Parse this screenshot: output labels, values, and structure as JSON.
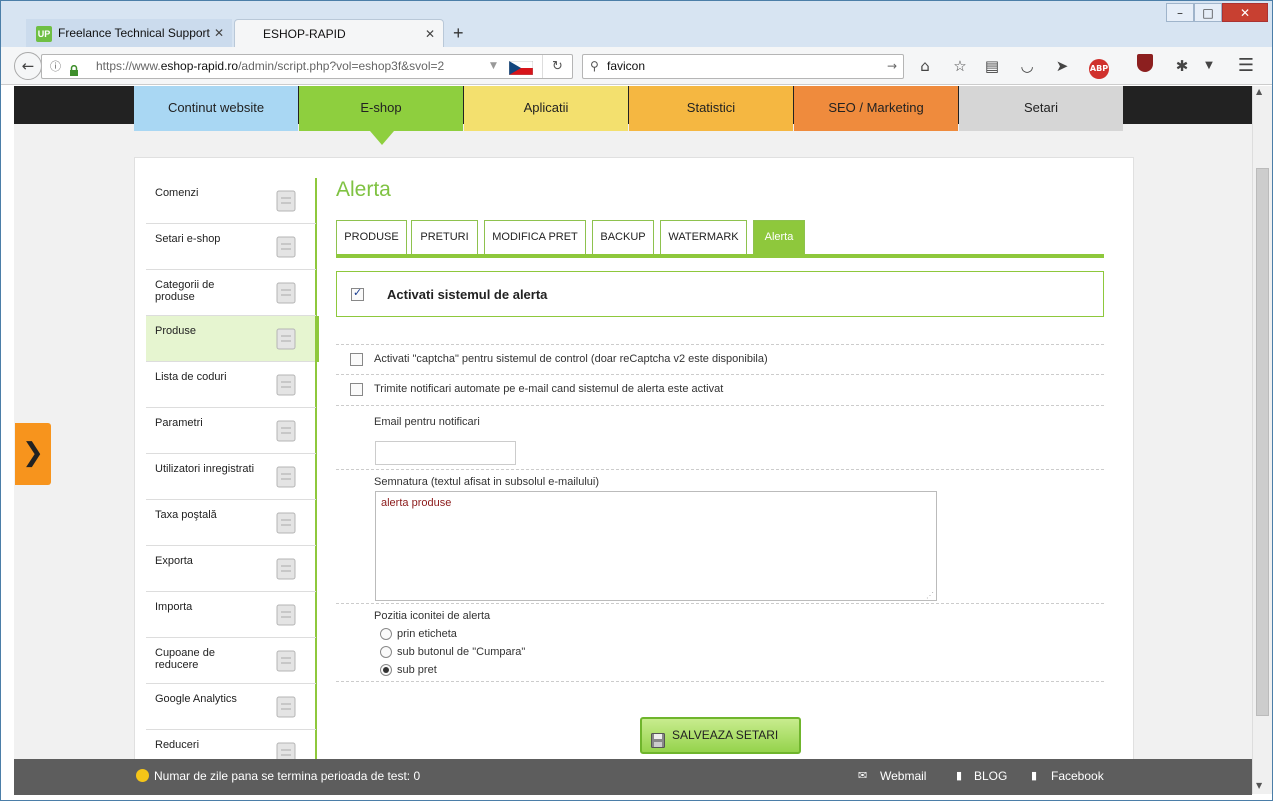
{
  "browser": {
    "tabs": [
      {
        "label": "Freelance Technical Support",
        "favicon": "UP"
      },
      {
        "label": "ESHOP-RAPID"
      }
    ],
    "new_tab": "+",
    "url": {
      "prefix": "https://www.",
      "host": "eshop-rapid.ro",
      "path": "/admin/script.php?vol=eshop3f&svol=2"
    },
    "search_value": "favicon",
    "extension_label": "ABP"
  },
  "main_nav": [
    {
      "label": "Continut website",
      "color": "#a9d7f3"
    },
    {
      "label": "E-shop",
      "color": "#8ecf3e"
    },
    {
      "label": "Aplicatii",
      "color": "#f3e06e"
    },
    {
      "label": "Statistici",
      "color": "#f5b741"
    },
    {
      "label": "SEO / Marketing",
      "color": "#ef8b3d"
    },
    {
      "label": "Setari",
      "color": "#d6d6d6"
    }
  ],
  "sidebar": {
    "items": [
      {
        "label": "Comenzi",
        "icon": "clipboard-icon"
      },
      {
        "label": "Setari e-shop",
        "icon": "tools-icon"
      },
      {
        "label": "Categorii de produse",
        "icon": "boxes-icon"
      },
      {
        "label": "Produse",
        "icon": "products-icon"
      },
      {
        "label": "Lista de coduri",
        "icon": "codes-icon"
      },
      {
        "label": "Parametri",
        "icon": "sliders-icon"
      },
      {
        "label": "Utilizatori inregistrati",
        "icon": "users-icon"
      },
      {
        "label": "Taxa poştală",
        "icon": "shipping-icon"
      },
      {
        "label": "Exporta",
        "icon": "upload-icon"
      },
      {
        "label": "Importa",
        "icon": "download-icon"
      },
      {
        "label": "Cupoane de reducere",
        "icon": "coupon-icon"
      },
      {
        "label": "Google Analytics",
        "icon": "analytics-icon"
      },
      {
        "label": "Reduceri",
        "icon": "discount-icon"
      }
    ]
  },
  "content": {
    "title": "Alerta",
    "subtabs": [
      "PRODUSE",
      "PRETURI",
      "MODIFICA PRET",
      "BACKUP",
      "WATERMARK",
      "Alerta"
    ],
    "activate_label": "Activati sistemul de alerta",
    "captcha_label": "Activati \"captcha\" pentru sistemul de control (doar reCaptcha v2 este disponibila)",
    "notify_label": "Trimite notificari automate pe e-mail cand sistemul de alerta este activat",
    "email_label": "Email pentru notificari",
    "email_value": "",
    "signature_label": "Semnatura (textul afisat in subsolul e-mailului)",
    "signature_value": "alerta produse",
    "position_label": "Pozitia iconitei de alerta",
    "position_options": [
      "prin eticheta",
      "sub butonul de \"Cumpara\"",
      "sub pret"
    ],
    "save_label": "SALVEAZA SETARI"
  },
  "footer": {
    "trial_text": "Numar de zile pana se termina perioada de test: 0",
    "webmail": "Webmail",
    "blog": "BLOG",
    "facebook": "Facebook"
  }
}
